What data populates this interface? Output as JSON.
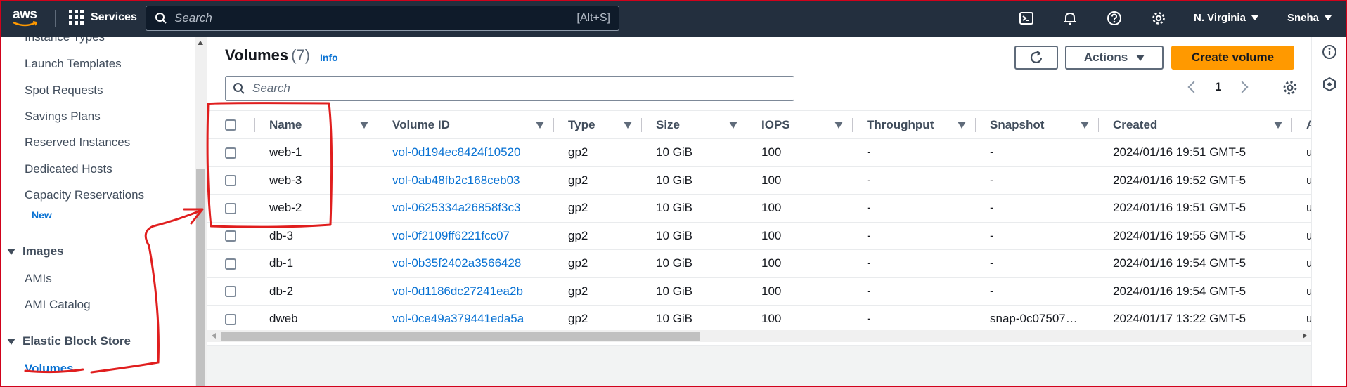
{
  "topnav": {
    "logo": "aws",
    "services_label": "Services",
    "search_placeholder": "Search",
    "search_shortcut": "[Alt+S]",
    "region": "N. Virginia",
    "user": "Sneha",
    "icons": [
      "cloudshell-icon",
      "notifications-icon",
      "help-icon",
      "settings-icon"
    ]
  },
  "sidebar": {
    "items_top": [
      {
        "label": "Instance Types"
      },
      {
        "label": "Launch Templates"
      },
      {
        "label": "Spot Requests"
      },
      {
        "label": "Savings Plans"
      },
      {
        "label": "Reserved Instances"
      },
      {
        "label": "Dedicated Hosts"
      },
      {
        "label": "Capacity Reservations"
      }
    ],
    "new_badge": "New",
    "sections": [
      {
        "title": "Images",
        "items": [
          {
            "label": "AMIs"
          },
          {
            "label": "AMI Catalog"
          }
        ]
      },
      {
        "title": "Elastic Block Store",
        "items": [
          {
            "label": "Volumes",
            "active": true
          }
        ]
      }
    ]
  },
  "main": {
    "title": "Volumes",
    "count": "(7)",
    "info": "Info",
    "actions_label": "Actions",
    "create_label": "Create volume",
    "search_placeholder": "Search",
    "page": "1",
    "columns": [
      "Name",
      "Volume ID",
      "Type",
      "Size",
      "IOPS",
      "Throughput",
      "Snapshot",
      "Created",
      "A"
    ],
    "rows": [
      {
        "name": "web-1",
        "id": "vol-0d194ec8424f10520",
        "type": "gp2",
        "size": "10 GiB",
        "iops": "100",
        "throughput": "-",
        "snapshot": "-",
        "created": "2024/01/16 19:51 GMT-5",
        "az": "u"
      },
      {
        "name": "web-3",
        "id": "vol-0ab48fb2c168ceb03",
        "type": "gp2",
        "size": "10 GiB",
        "iops": "100",
        "throughput": "-",
        "snapshot": "-",
        "created": "2024/01/16 19:52 GMT-5",
        "az": "u"
      },
      {
        "name": "web-2",
        "id": "vol-0625334a26858f3c3",
        "type": "gp2",
        "size": "10 GiB",
        "iops": "100",
        "throughput": "-",
        "snapshot": "-",
        "created": "2024/01/16 19:51 GMT-5",
        "az": "u"
      },
      {
        "name": "db-3",
        "id": "vol-0f2109ff6221fcc07",
        "type": "gp2",
        "size": "10 GiB",
        "iops": "100",
        "throughput": "-",
        "snapshot": "-",
        "created": "2024/01/16 19:55 GMT-5",
        "az": "u"
      },
      {
        "name": "db-1",
        "id": "vol-0b35f2402a3566428",
        "type": "gp2",
        "size": "10 GiB",
        "iops": "100",
        "throughput": "-",
        "snapshot": "-",
        "created": "2024/01/16 19:54 GMT-5",
        "az": "u"
      },
      {
        "name": "db-2",
        "id": "vol-0d1186dc27241ea2b",
        "type": "gp2",
        "size": "10 GiB",
        "iops": "100",
        "throughput": "-",
        "snapshot": "-",
        "created": "2024/01/16 19:54 GMT-5",
        "az": "u"
      },
      {
        "name": "dweb",
        "id": "vol-0ce49a379441eda5a",
        "type": "gp2",
        "size": "10 GiB",
        "iops": "100",
        "throughput": "-",
        "snapshot": "snap-0c07507…",
        "created": "2024/01/17 13:22 GMT-5",
        "az": "u"
      }
    ]
  },
  "colors": {
    "nav_bg": "#232f3e",
    "primary_button": "#ff9900",
    "link": "#0972d3",
    "annotation": "#d0021b"
  }
}
